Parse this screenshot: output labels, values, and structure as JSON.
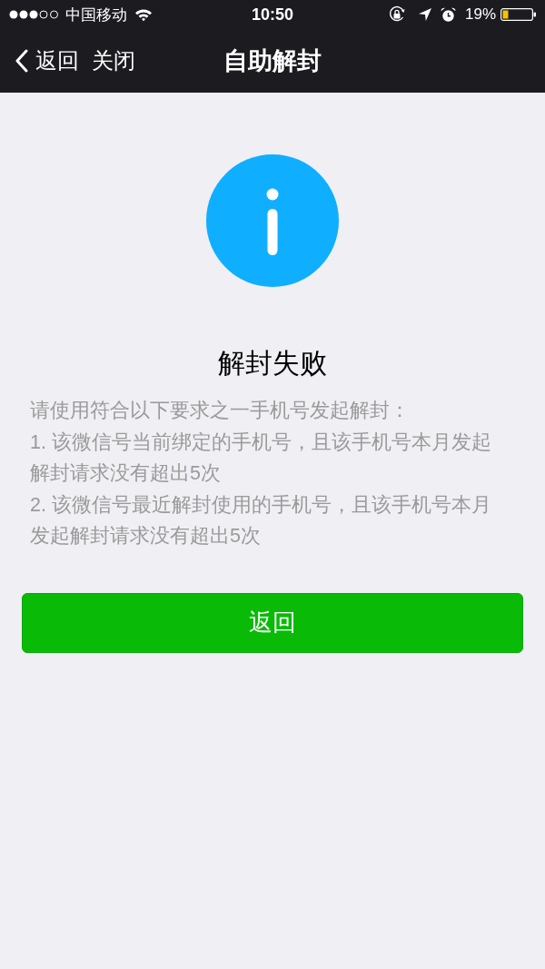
{
  "status_bar": {
    "carrier": "中国移动",
    "time": "10:50",
    "battery": "19%"
  },
  "nav_bar": {
    "back": "返回",
    "close": "关闭",
    "title": "自助解封"
  },
  "result": {
    "title": "解封失败",
    "intro": "请使用符合以下要求之一手机号发起解封：",
    "items": [
      "1. 该微信号当前绑定的手机号，且该手机号本月发起解封请求没有超出5次",
      "2. 该微信号最近解封使用的手机号，且该手机号本月发起解封请求没有超出5次"
    ]
  },
  "button": {
    "label": "返回"
  }
}
